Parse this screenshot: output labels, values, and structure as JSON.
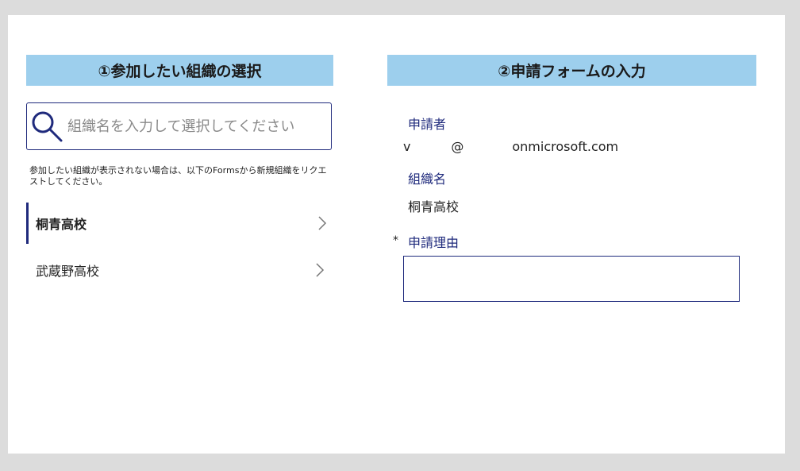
{
  "left_panel": {
    "header": "①参加したい組織の選択",
    "search": {
      "placeholder": "組織名を入力して選択してください",
      "value": "",
      "icon": "search-icon"
    },
    "note": "参加したい組織が表示されない場合は、以下のFormsから新規組織をリクエストしてください。",
    "organizations": [
      {
        "label": "桐青高校",
        "selected": true,
        "icon": "chevron-right-icon"
      },
      {
        "label": "武蔵野高校",
        "selected": false,
        "icon": "chevron-right-icon"
      }
    ]
  },
  "right_panel": {
    "header": "②申請フォームの入力",
    "applicant_label": "申請者",
    "applicant_value": "v          @            onmicrosoft.com",
    "org_label": "組織名",
    "org_value": "桐青高校",
    "reason_label": "申請理由",
    "reason_required_mark": "*",
    "reason_value": ""
  },
  "colors": {
    "header_bg": "#9dcfed",
    "accent": "#1f2a7c",
    "frame": "#dcdcdc"
  }
}
